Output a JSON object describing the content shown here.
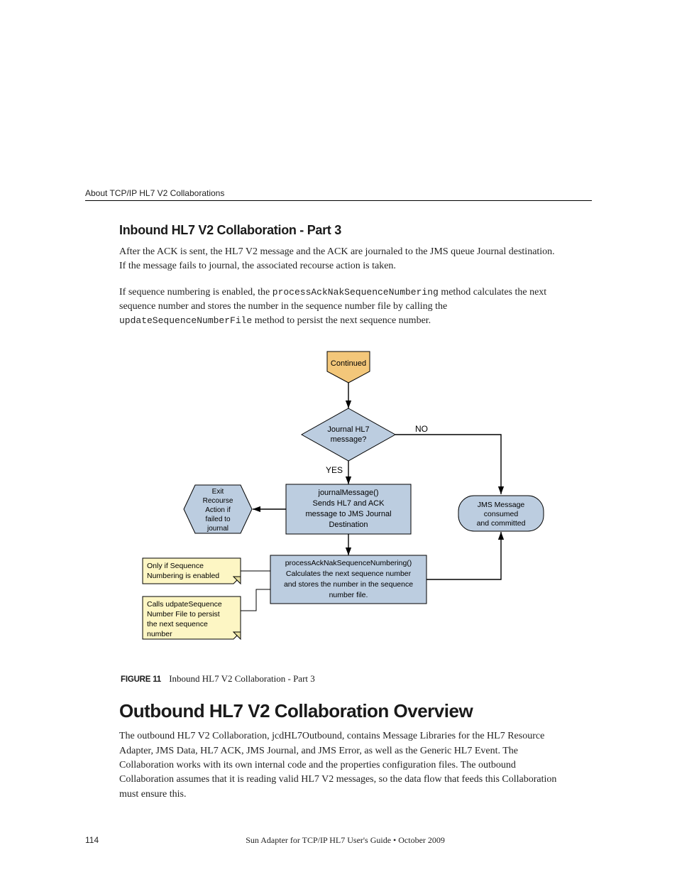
{
  "header": {
    "running": "About TCP/IP HL7 V2 Collaborations"
  },
  "section1": {
    "title": "Inbound HL7 V2 Collaboration - Part 3",
    "para1": "After the ACK is sent, the HL7 V2 message and the ACK are journaled to the JMS queue Journal destination. If the message fails to journal, the associated recourse action is taken.",
    "para2a": "If sequence numbering is enabled, the ",
    "code2a": "processAckNakSequenceNumbering",
    "para2b": " method calculates the next sequence number and stores the number in the sequence number file by calling the ",
    "code2b": "updateSequenceNumberFile",
    "para2c": " method to persist the next sequence number."
  },
  "figure": {
    "label": "FIGURE 11",
    "caption": "Inbound HL7 V2 Collaboration - Part 3",
    "nodes": {
      "continued": "Continued",
      "decision_l1": "Journal HL7",
      "decision_l2": "message?",
      "yes": "YES",
      "no": "NO",
      "hex_l1": "Exit",
      "hex_l2": "Recourse",
      "hex_l3": "Action if",
      "hex_l4": "failed to",
      "hex_l5": "journal",
      "journal_l1": "journalMessage()",
      "journal_l2": "Sends HL7 and ACK",
      "journal_l3": "message to JMS Journal",
      "journal_l4": "Destination",
      "seq_l1": "processAckNakSequenceNumbering()",
      "seq_l2": "Calculates the next sequence number",
      "seq_l3": "and stores the number in the sequence",
      "seq_l4": "number file.",
      "term_l1": "JMS Message",
      "term_l2": "consumed",
      "term_l3": "and committed",
      "note1_l1": "Only if Sequence",
      "note1_l2": "Numbering is enabled",
      "note2_l1": "Calls udpateSequence",
      "note2_l2": "Number File to persist",
      "note2_l3": "the next sequence",
      "note2_l4": "number"
    }
  },
  "section2": {
    "title": "Outbound HL7 V2 Collaboration Overview",
    "para1": "The outbound HL7 V2 Collaboration, jcdHL7Outbound, contains Message Libraries for the HL7 Resource Adapter, JMS Data, HL7 ACK, JMS Journal, and JMS Error, as well as the Generic HL7 Event. The Collaboration works with its own internal code and the properties configuration files. The outbound Collaboration assumes that it is reading valid HL7 V2 messages, so the data flow that feeds this Collaboration must ensure this."
  },
  "footer": {
    "page": "114",
    "text": "Sun Adapter for TCP/IP HL7 User's Guide  •  October 2009"
  }
}
